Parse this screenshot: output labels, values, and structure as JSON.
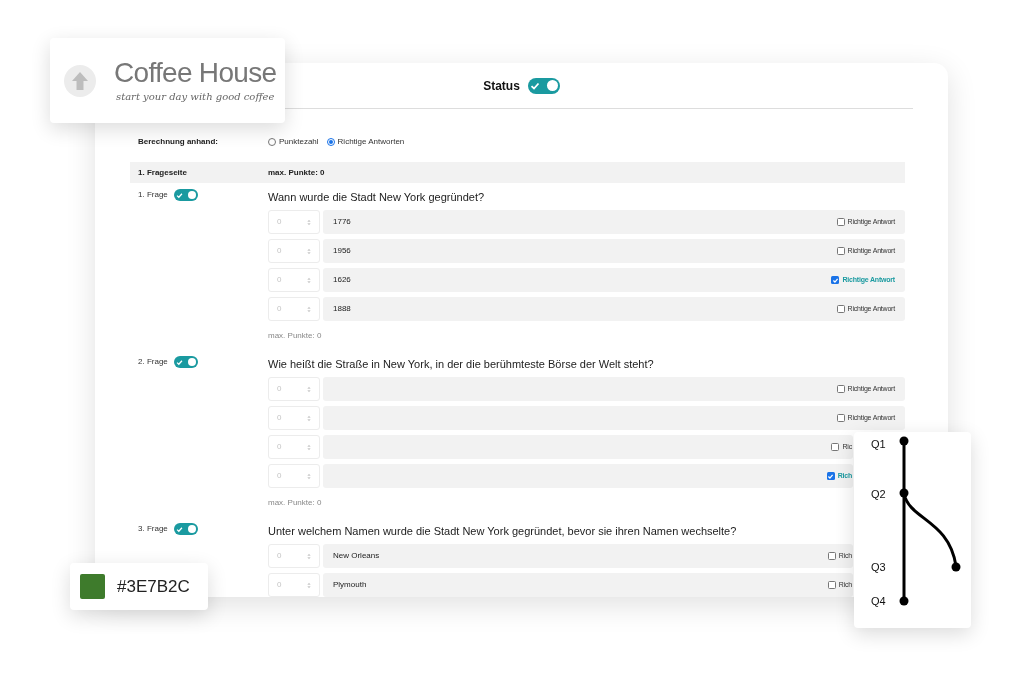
{
  "logo_card": {
    "title": "Coffee House",
    "tagline": "start your day with good coffee"
  },
  "status": {
    "label": "Status",
    "on": true
  },
  "calculation": {
    "label": "Berechnung anhand:",
    "options": [
      {
        "label": "Punktezahl",
        "selected": false
      },
      {
        "label": "Richtige Antworten",
        "selected": true
      }
    ]
  },
  "page_header": {
    "title": "1. Frageseite",
    "max_points": "max. Punkte: 0"
  },
  "questions": [
    {
      "label": "1. Frage",
      "on": true,
      "text": "Wann wurde die Stadt New York gegründet?",
      "answers": [
        {
          "points": "0",
          "value": "1776",
          "correct_label": "Richtige Antwort",
          "checked": false
        },
        {
          "points": "0",
          "value": "1956",
          "correct_label": "Richtige Antwort",
          "checked": false
        },
        {
          "points": "0",
          "value": "1626",
          "correct_label": "Richtige Antwort",
          "checked": true
        },
        {
          "points": "0",
          "value": "1888",
          "correct_label": "Richtige Antwort",
          "checked": false
        }
      ],
      "max_points": "max. Punkte: 0"
    },
    {
      "label": "2. Frage",
      "on": true,
      "text": "Wie heißt die Straße in New York, in der die berühmteste Börse der Welt steht?",
      "answers": [
        {
          "points": "0",
          "correct_label": "Richtige Antwort",
          "checked": false
        },
        {
          "points": "0",
          "correct_label": "Richtige Antwort",
          "checked": false
        },
        {
          "points": "0",
          "correct_label": "Ric",
          "checked": false
        },
        {
          "points": "0",
          "correct_label": "Rich",
          "checked": true
        }
      ],
      "max_points": "max. Punkte: 0"
    },
    {
      "label": "3. Frage",
      "on": true,
      "text": "Unter welchem Namen wurde die Stadt New York gegründet, bevor sie ihren Namen wechselte?",
      "answers": [
        {
          "points": "0",
          "value": "New Orleans",
          "correct_label": "Rich",
          "checked": false
        },
        {
          "points": "0",
          "value": "Plymouth",
          "correct_label": "Rich",
          "checked": false
        }
      ]
    }
  ],
  "color_card": {
    "color": "#3e7b2c",
    "hex": "#3E7B2C"
  },
  "flow_card": {
    "nodes": [
      "Q1",
      "Q2",
      "Q3",
      "Q4"
    ]
  }
}
